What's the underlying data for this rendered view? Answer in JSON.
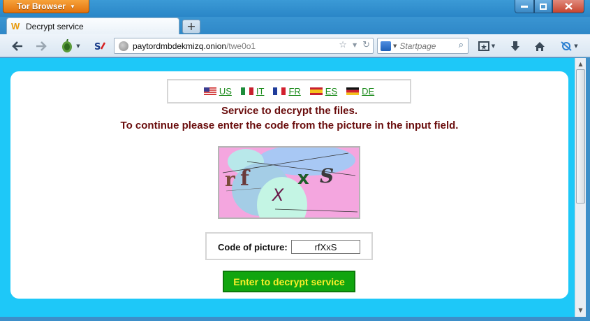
{
  "browser": {
    "menu_button": "Tor Browser",
    "tab_title": "Decrypt service",
    "tab_favicon": "W",
    "newtab_label": "+",
    "url_host": "paytordmbdekmizq.onion",
    "url_path": "/twe0o1",
    "search_placeholder": "Startpage",
    "icons": [
      "back-icon",
      "forward-icon",
      "tor-onion-icon",
      "noscript-icon",
      "globe-icon",
      "star-icon",
      "reload-icon",
      "search-icon",
      "bookmarks-icon",
      "download-icon",
      "home-icon",
      "https-everywhere-icon"
    ]
  },
  "page": {
    "languages": [
      {
        "code": "US",
        "label": "US"
      },
      {
        "code": "IT",
        "label": "IT"
      },
      {
        "code": "FR",
        "label": "FR"
      },
      {
        "code": "ES",
        "label": "ES"
      },
      {
        "code": "DE",
        "label": "DE"
      }
    ],
    "heading_line1": "Service to decrypt the files.",
    "heading_line2": "To continue please enter the code from the picture in the input field.",
    "captcha_letters": [
      "r",
      "f",
      "X",
      "x",
      "S"
    ],
    "code_label": "Code of picture:",
    "code_value": "rfXxS",
    "submit_label": "Enter to decrypt service"
  },
  "colors": {
    "background": "#1ec8f8",
    "heading": "#6a0d0d",
    "link": "#1d8c1d",
    "button_bg": "#11a50f",
    "button_text": "#f8ee2a"
  }
}
